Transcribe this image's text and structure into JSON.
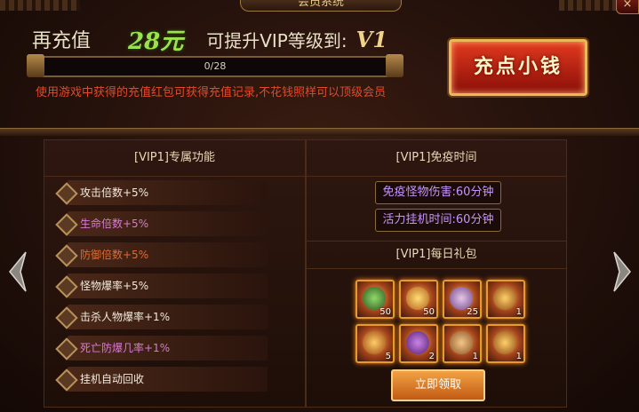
{
  "header": {
    "title": "会员系统",
    "close_label": "×"
  },
  "top": {
    "recharge_prefix": "再充值",
    "amount": "28元",
    "upgrade_text": "可提升VIP等级到:",
    "target_vip": "V1",
    "progress": {
      "text": "0/28",
      "current": 0,
      "max": 28
    },
    "notice": "使用游戏中获得的充值红包可获得充值记录,不花钱照样可以顶级会员",
    "recharge_button": "充点小钱"
  },
  "left_panel": {
    "title": "[VIP1]专属功能",
    "features": [
      {
        "label": "攻击倍数+5%",
        "color": "#f2eadb"
      },
      {
        "label": "生命倍数+5%",
        "color": "#d87ad4"
      },
      {
        "label": "防御倍数+5%",
        "color": "#e46a2e"
      },
      {
        "label": "怪物爆率+5%",
        "color": "#f2eadb"
      },
      {
        "label": "击杀人物爆率+1%",
        "color": "#f2eadb"
      },
      {
        "label": "死亡防爆几率+1%",
        "color": "#d87ad4"
      },
      {
        "label": "挂机自动回收",
        "color": "#f2eadb"
      }
    ]
  },
  "right_panel": {
    "immunity_title": "[VIP1]免疫时间",
    "immunity_items": [
      "免疫怪物伤害:60分钟",
      "活力挂机时间:60分钟"
    ],
    "gift_title": "[VIP1]每日礼包",
    "gift_items": [
      {
        "icon": "green-orb-icon",
        "count": "50"
      },
      {
        "icon": "gold-coin-icon",
        "count": "50"
      },
      {
        "icon": "crystal-cluster-icon",
        "count": "25"
      },
      {
        "icon": "gold-ingot-icon",
        "count": "1"
      },
      {
        "icon": "treasure-pot-icon",
        "count": "5"
      },
      {
        "icon": "purple-scroll-icon",
        "count": "2"
      },
      {
        "icon": "treasure-bag-icon",
        "count": "1"
      },
      {
        "icon": "gold-ingot-icon",
        "count": "1"
      }
    ],
    "claim_button": "立即领取"
  }
}
